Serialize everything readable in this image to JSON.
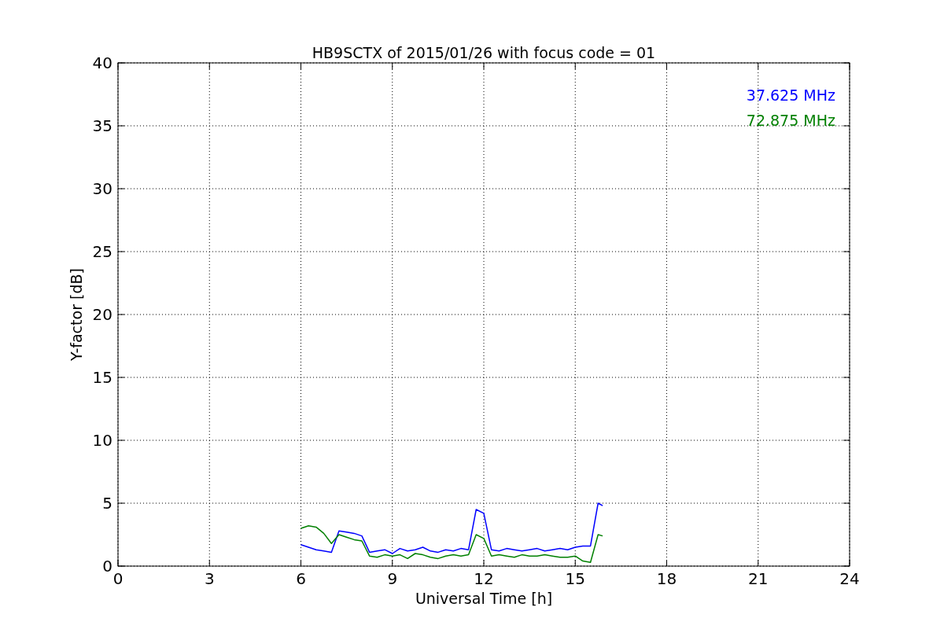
{
  "chart_data": {
    "type": "line",
    "title": "HB9SCTX of 2015/01/26 with focus code = 01",
    "xlabel": "Universal Time [h]",
    "ylabel": "Y-factor [dB]",
    "x": [
      6,
      6.25,
      6.5,
      6.75,
      7,
      7.25,
      7.5,
      7.75,
      8,
      8.25,
      8.5,
      8.75,
      9,
      9.25,
      9.5,
      9.75,
      10,
      10.25,
      10.5,
      10.75,
      11,
      11.25,
      11.5,
      11.75,
      12,
      12.25,
      12.5,
      12.75,
      13,
      13.25,
      13.5,
      13.75,
      14,
      14.25,
      14.5,
      14.75,
      15,
      15.25,
      15.5,
      15.75,
      15.9
    ],
    "series": [
      {
        "name": "37.625 MHz",
        "color": "#0000ff",
        "values": [
          1.7,
          1.5,
          1.3,
          1.2,
          1.1,
          2.8,
          2.7,
          2.6,
          2.4,
          1.1,
          1.2,
          1.3,
          1.0,
          1.4,
          1.2,
          1.3,
          1.5,
          1.2,
          1.1,
          1.3,
          1.2,
          1.4,
          1.3,
          4.5,
          4.2,
          1.3,
          1.2,
          1.4,
          1.3,
          1.2,
          1.3,
          1.4,
          1.2,
          1.3,
          1.4,
          1.3,
          1.5,
          1.6,
          1.6,
          5.0,
          4.8
        ]
      },
      {
        "name": "72.875 MHz",
        "color": "#008000",
        "values": [
          3.0,
          3.2,
          3.1,
          2.6,
          1.8,
          2.5,
          2.3,
          2.1,
          2.0,
          0.8,
          0.7,
          0.9,
          0.8,
          0.9,
          0.6,
          1.0,
          0.9,
          0.7,
          0.6,
          0.8,
          0.9,
          0.8,
          0.9,
          2.5,
          2.2,
          0.8,
          0.9,
          0.8,
          0.7,
          0.9,
          0.8,
          0.8,
          0.9,
          0.8,
          0.7,
          0.7,
          0.8,
          0.4,
          0.3,
          2.5,
          2.4
        ]
      }
    ],
    "xlim": [
      0,
      24
    ],
    "ylim": [
      0,
      40
    ],
    "grid": true,
    "xticks": [
      0,
      3,
      6,
      9,
      12,
      15,
      18,
      21,
      24
    ],
    "yticks": [
      0,
      5,
      10,
      15,
      20,
      25,
      30,
      35,
      40
    ]
  }
}
